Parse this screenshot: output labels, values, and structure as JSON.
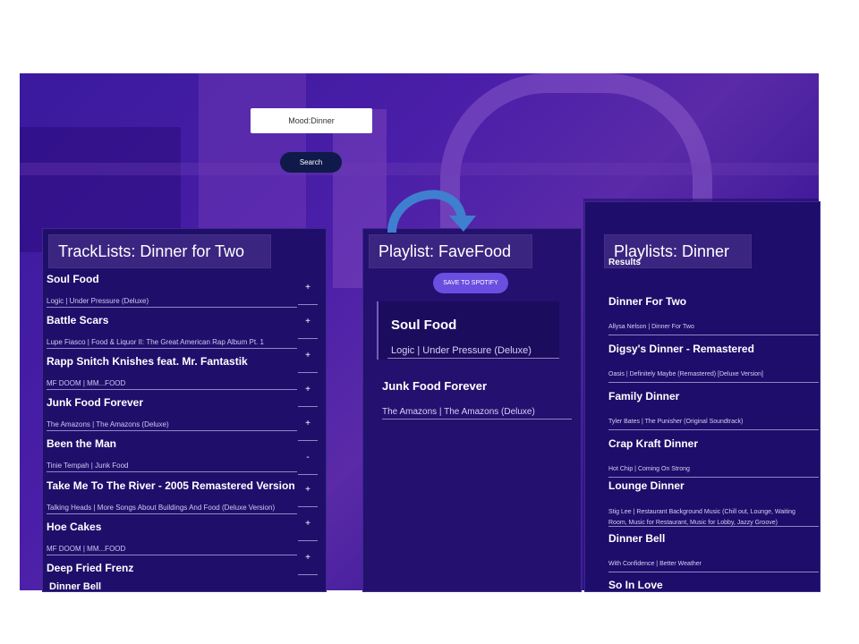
{
  "mood_input": {
    "value": "Mood:Dinner"
  },
  "search_button": {
    "label": "Search"
  },
  "tracklists": {
    "header": "TrackLists: Dinner  for Two",
    "items": [
      {
        "title": "Soul Food",
        "subtitle": "Logic | Under Pressure (Deluxe)",
        "action": "+"
      },
      {
        "title": "Battle Scars",
        "subtitle": "Lupe Fiasco | Food & Liquor II: The Great American Rap Album Pt. 1",
        "action": "+"
      },
      {
        "title": "Rapp Snitch Knishes feat. Mr. Fantastik",
        "subtitle": "MF DOOM | MM...FOOD",
        "action": "+"
      },
      {
        "title": "Junk Food Forever",
        "subtitle": "The Amazons | The Amazons (Deluxe)",
        "action": "+"
      },
      {
        "title": "Been the Man",
        "subtitle": "Tinie Tempah | Junk Food",
        "action": "+"
      },
      {
        "title": "Take Me To The River - 2005 Remastered Version",
        "subtitle": "Talking Heads | More Songs About Buildings And Food (Deluxe Version)",
        "action": "-"
      },
      {
        "title": "Hoe Cakes",
        "subtitle": "MF DOOM | MM...FOOD",
        "action": "+"
      },
      {
        "title": "Deep Fried Frenz",
        "subtitle": "",
        "action": "+"
      }
    ],
    "cutoff_item": "Dinner Bell"
  },
  "playlist": {
    "header": "Playlist: FaveFood",
    "save_button": "SAVE TO SPOTIFY",
    "items": [
      {
        "title": "Soul Food",
        "subtitle": "Logic | Under Pressure (Deluxe)"
      },
      {
        "title": "Junk Food Forever",
        "subtitle": "The Amazons | The Amazons (Deluxe)"
      }
    ]
  },
  "playlists": {
    "header": "Playlists:  Dinner",
    "results_label": "Results",
    "items": [
      {
        "title": "Dinner For Two",
        "subtitle": "Allysa Nelson | Dinner For Two"
      },
      {
        "title": "Digsy's Dinner - Remastered",
        "subtitle": "Oasis | Definitely Maybe (Remastered) [Deluxe Version]"
      },
      {
        "title": "Family Dinner",
        "subtitle": "Tyler Bates | The Punisher (Original Soundtrack)"
      },
      {
        "title": "Crap Kraft Dinner",
        "subtitle": "Hot Chip | Coming On Strong"
      },
      {
        "title": "Lounge Dinner",
        "subtitle": "Stig Lee | Restaurant Background Music (Chill out, Lounge, Waiting Room, Music for Restaurant, Music for Lobby, Jazzy Groove)"
      },
      {
        "title": "Dinner Bell",
        "subtitle": "With Confidence | Better Weather"
      },
      {
        "title": "So In Love",
        "subtitle": ""
      }
    ]
  },
  "colors": {
    "panel": "#1f0f6b",
    "accent": "#6a4ee0",
    "header_bg": "#3a2580",
    "arrow": "#3f7fcf"
  }
}
